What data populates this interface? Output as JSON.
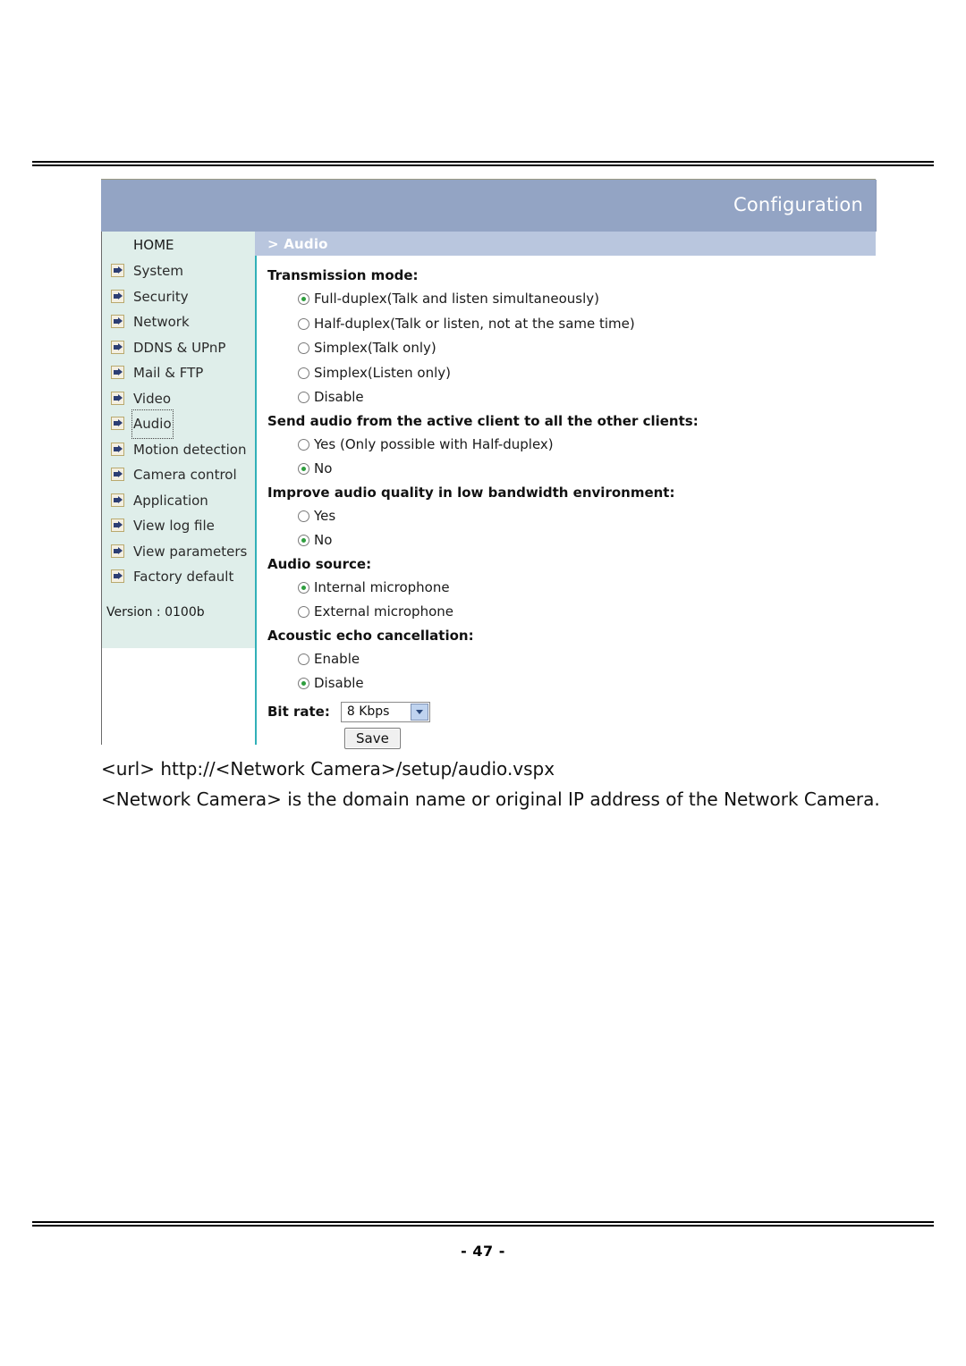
{
  "document": {
    "page_number": "- 47 -",
    "caption_url_line": "<url> http://<Network Camera>/setup/audio.vspx",
    "caption_note_line": "<Network Camera> is the domain name or original IP address of the Network Camera."
  },
  "screenshot": {
    "titlebar": {
      "title": "Configuration"
    },
    "breadcrumb": "> Audio",
    "sidebar": {
      "home_label": "HOME",
      "items": [
        {
          "label": "System",
          "focused": false
        },
        {
          "label": "Security",
          "focused": false
        },
        {
          "label": "Network",
          "focused": false
        },
        {
          "label": "DDNS & UPnP",
          "focused": false
        },
        {
          "label": "Mail & FTP",
          "focused": false
        },
        {
          "label": "Video",
          "focused": false
        },
        {
          "label": "Audio",
          "focused": true
        },
        {
          "label": "Motion detection",
          "focused": false
        },
        {
          "label": "Camera control",
          "focused": false
        },
        {
          "label": "Application",
          "focused": false
        },
        {
          "label": "View log file",
          "focused": false
        },
        {
          "label": "View parameters",
          "focused": false
        },
        {
          "label": "Factory default",
          "focused": false
        }
      ],
      "version": "Version : 0100b"
    },
    "form": {
      "transmission_mode": {
        "label": "Transmission mode:",
        "options": [
          {
            "label": "Full-duplex(Talk and listen simultaneously)",
            "selected": true
          },
          {
            "label": "Half-duplex(Talk or listen, not at the same time)",
            "selected": false
          },
          {
            "label": "Simplex(Talk only)",
            "selected": false
          },
          {
            "label": "Simplex(Listen only)",
            "selected": false
          },
          {
            "label": "Disable",
            "selected": false
          }
        ]
      },
      "send_audio": {
        "label": "Send audio from the active client to all the other clients:",
        "options": [
          {
            "label": "Yes (Only possible with Half-duplex)",
            "selected": false
          },
          {
            "label": "No",
            "selected": true
          }
        ]
      },
      "improve_quality": {
        "label": "Improve audio quality in low bandwidth environment:",
        "options": [
          {
            "label": "Yes",
            "selected": false
          },
          {
            "label": "No",
            "selected": true
          }
        ]
      },
      "audio_source": {
        "label": "Audio source:",
        "options": [
          {
            "label": "Internal microphone",
            "selected": true
          },
          {
            "label": "External microphone",
            "selected": false
          }
        ]
      },
      "echo_cancellation": {
        "label": "Acoustic echo cancellation:",
        "options": [
          {
            "label": "Enable",
            "selected": false
          },
          {
            "label": "Disable",
            "selected": true
          }
        ]
      },
      "bit_rate": {
        "label": "Bit rate:",
        "value": "8 Kbps"
      },
      "save_label": "Save"
    },
    "colors": {
      "titlebar": "#93a4c4",
      "breadcrumb_bar": "#b9c6de",
      "sidebar_bg": "#dfeeea",
      "divider": "#31b0b8",
      "radio_dot": "#2e9e3e"
    }
  }
}
